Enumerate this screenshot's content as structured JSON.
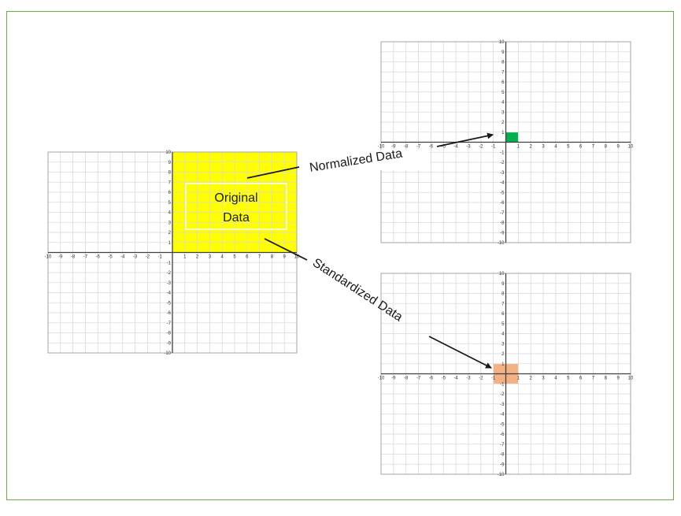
{
  "diagram": {
    "axis_range": [
      -10,
      10
    ],
    "colors": {
      "frame": "#70ad47",
      "grid": "#d9d9d9",
      "axis": "#404040",
      "original_fill": "#ffff00",
      "normalized_fill": "#00b050",
      "standardized_fill": "#f4b183",
      "arrow": "#1a1a1a"
    },
    "original": {
      "label_line1": "Original",
      "label_line2": "Data",
      "region": {
        "x": [
          0,
          10
        ],
        "y": [
          0,
          10
        ]
      }
    },
    "normalized": {
      "label": "Normalized Data",
      "region": {
        "x": [
          0,
          1
        ],
        "y": [
          0,
          1
        ]
      }
    },
    "standardized": {
      "label": "Standardized Data",
      "region": {
        "x": [
          -1,
          1
        ],
        "y": [
          -1,
          1
        ]
      }
    }
  }
}
